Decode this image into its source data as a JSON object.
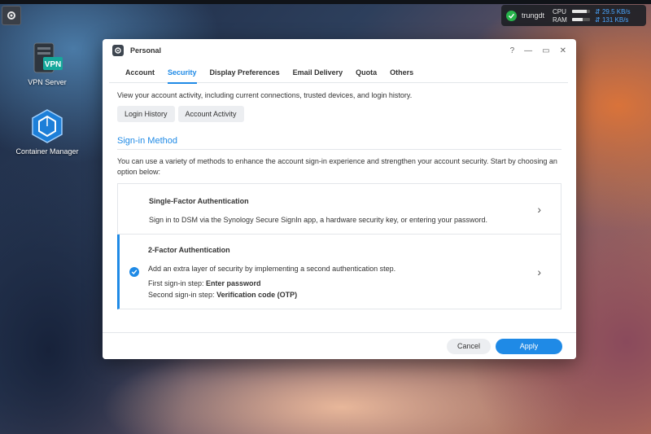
{
  "desktop": {
    "icons": [
      {
        "label": "VPN Server",
        "badge": "VPN"
      },
      {
        "label": "Container Manager"
      }
    ]
  },
  "sysbar": {
    "user": "trungdt",
    "cpu_label": "CPU",
    "cpu_rate": "29.5 KB/s",
    "cpu_fill": 0.8,
    "ram_label": "RAM",
    "ram_rate": "131 KB/s",
    "ram_fill": 0.6
  },
  "window": {
    "title": "Personal",
    "controls": {
      "help": "?",
      "minimize": "—",
      "maximize": "▭",
      "close": "✕"
    },
    "tabs": [
      "Account",
      "Security",
      "Display Preferences",
      "Email Delivery",
      "Quota",
      "Others"
    ],
    "active_tab": "Security",
    "intro": "View your account activity, including current connections, trusted devices, and login history.",
    "buttons": {
      "login_history": "Login History",
      "account_activity": "Account Activity"
    },
    "section_title": "Sign-in Method",
    "section_desc": "You can use a variety of methods to enhance the account sign-in experience and strengthen your account security. Start by choosing an option below:",
    "options": {
      "single": {
        "title": "Single-Factor Authentication",
        "desc": "Sign in to DSM via the Synology Secure SignIn app, a hardware security key, or entering your password."
      },
      "two": {
        "title": "2-Factor Authentication",
        "desc": "Add an extra layer of security by implementing a second authentication step.",
        "step1_label": "First sign-in step: ",
        "step1_value": "Enter password",
        "step2_label": "Second sign-in step: ",
        "step2_value": "Verification code (OTP)"
      }
    },
    "footer": {
      "cancel": "Cancel",
      "apply": "Apply"
    }
  },
  "colors": {
    "accent": "#1f8ae6"
  }
}
